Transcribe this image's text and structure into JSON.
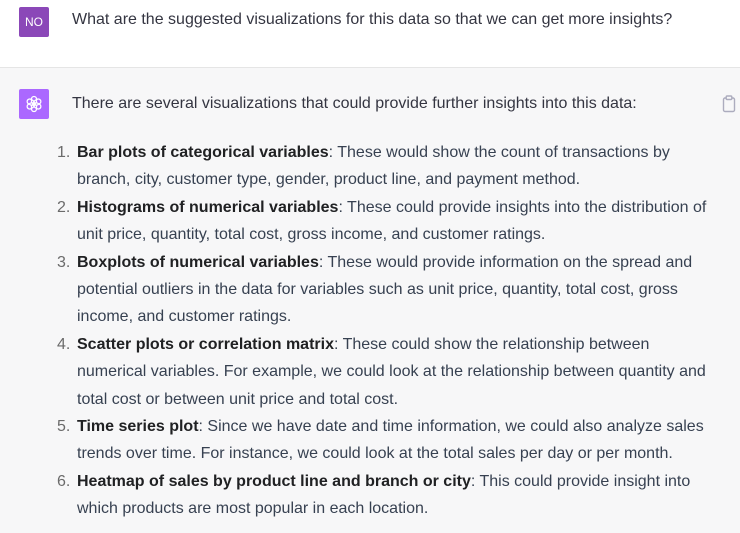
{
  "user": {
    "avatar_initials": "NO",
    "avatar_color": "#8B48B8",
    "message": "What are the suggested visualizations for this data so that we can get more insights?"
  },
  "assistant": {
    "avatar_icon": "openai-logo-icon",
    "avatar_color": "#AB68FF",
    "copy_icon": "clipboard-icon",
    "intro": "There are several visualizations that could provide further insights into this data:",
    "items": [
      {
        "number": "1.",
        "title": "Bar plots of categorical variables",
        "text": ": These would show the count of transactions by branch, city, customer type, gender, product line, and payment method."
      },
      {
        "number": "2.",
        "title": "Histograms of numerical variables",
        "text": ": These could provide insights into the distribution of unit price, quantity, total cost, gross income, and customer ratings."
      },
      {
        "number": "3.",
        "title": "Boxplots of numerical variables",
        "text": ": These would provide information on the spread and potential outliers in the data for variables such as unit price, quantity, total cost, gross income, and customer ratings."
      },
      {
        "number": "4.",
        "title": "Scatter plots or correlation matrix",
        "text": ": These could show the relationship between numerical variables. For example, we could look at the relationship between quantity and total cost or between unit price and total cost."
      },
      {
        "number": "5.",
        "title": "Time series plot",
        "text": ": Since we have date and time information, we could also analyze sales trends over time. For instance, we could look at the total sales per day or per month."
      },
      {
        "number": "6.",
        "title": "Heatmap of sales by product line and branch or city",
        "text": ": This could provide insight into which products are most popular in each location."
      }
    ]
  }
}
